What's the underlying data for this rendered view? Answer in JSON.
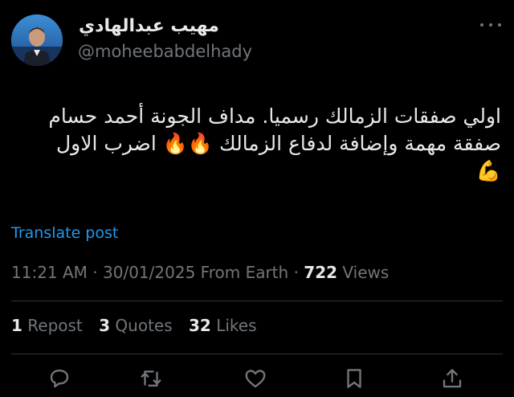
{
  "user": {
    "display_name": "مهيب عبدالهادي",
    "handle": "@moheebabdelhady"
  },
  "tweet": {
    "line1": "اولي صفقات الزمالك رسميا. مداف الجونة أحمد حسام",
    "line2": "صفقة مهمة وإضافة لدفاع الزمالك 🔥🔥 اضرب الاول",
    "line3": "💪"
  },
  "translate_label": "Translate post",
  "meta": {
    "time": "11:21 AM",
    "date": "30/01/2025",
    "source": "From Earth",
    "views_count": "722",
    "views_label": "Views",
    "separator": "·"
  },
  "stats": {
    "reposts_count": "1",
    "reposts_label": "Repost",
    "quotes_count": "3",
    "quotes_label": "Quotes",
    "likes_count": "32",
    "likes_label": "Likes"
  },
  "icons": {
    "more": "more-horizontal-icon",
    "reply": "reply-icon",
    "repost": "repost-icon",
    "like": "heart-icon",
    "bookmark": "bookmark-icon",
    "share": "share-icon"
  },
  "colors": {
    "background": "#000000",
    "text": "#e7e9ea",
    "muted": "#71767b",
    "link": "#1d9bf0",
    "divider": "#2f3336"
  }
}
